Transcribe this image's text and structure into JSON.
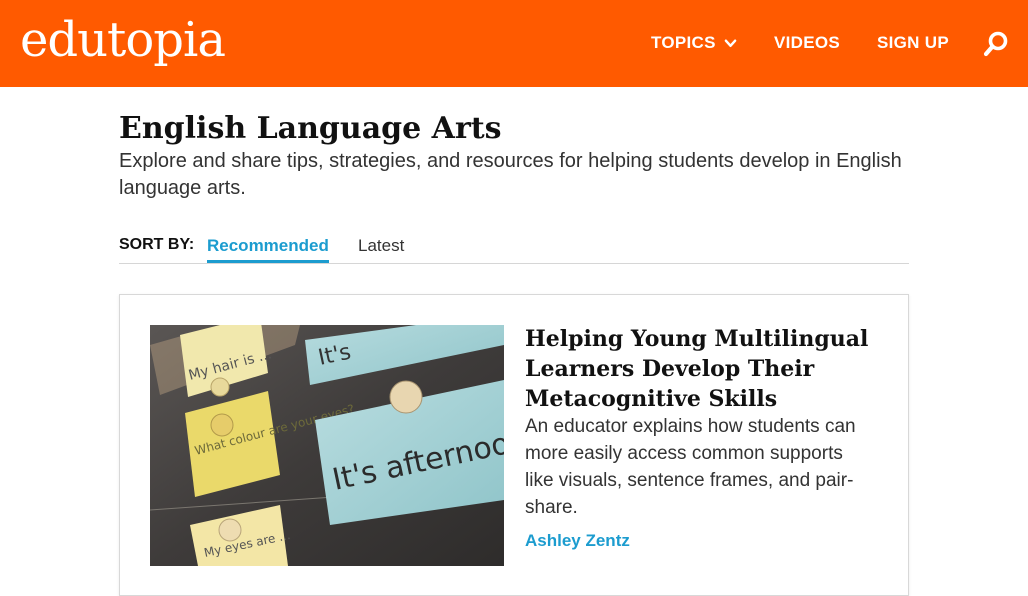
{
  "header": {
    "logo": "edutopia",
    "nav": {
      "topics": "TOPICS",
      "videos": "VIDEOS",
      "signup": "SIGN UP"
    },
    "search_icon": "search-icon",
    "brand_color": "#ff5a00"
  },
  "page": {
    "title": "English Language Arts",
    "description": "Explore and share tips, strategies, and resources for helping students develop in English language arts."
  },
  "sort": {
    "label": "SORT BY:",
    "options": [
      "Recommended",
      "Latest"
    ],
    "selected": "Recommended",
    "accent_color": "#1c9ccf"
  },
  "article": {
    "title": "Helping Young Multilingual Learners Develop Their Metacognitive Skills",
    "description": "An educator explains how students can more easily access common supports like visuals, sentence frames, and pair-share.",
    "author": "Ashley Zentz",
    "image_cards": {
      "hair": "My hair is ...",
      "colour": "What colour are your eyes?",
      "eyes": "My eyes are ...",
      "afternoon": "It's afternoon.",
      "its": "It's"
    }
  }
}
